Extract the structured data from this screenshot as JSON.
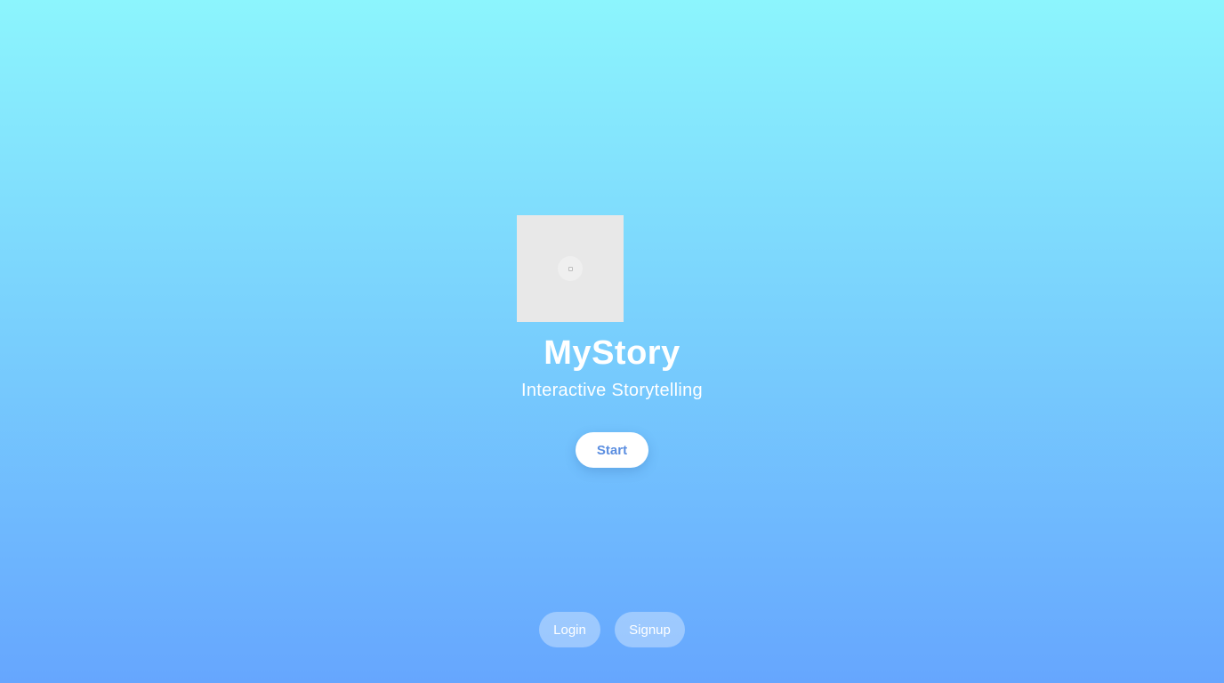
{
  "app": {
    "title": "MyStory",
    "subtitle": "Interactive Storytelling"
  },
  "logo": {
    "icon": "loading-spinner-icon"
  },
  "actions": {
    "start_label": "Start",
    "login_label": "Login",
    "signup_label": "Signup"
  },
  "colors": {
    "gradient_top": "#8cf5fd",
    "gradient_bottom": "#66a6fe",
    "start_text": "#5b8ee0"
  }
}
